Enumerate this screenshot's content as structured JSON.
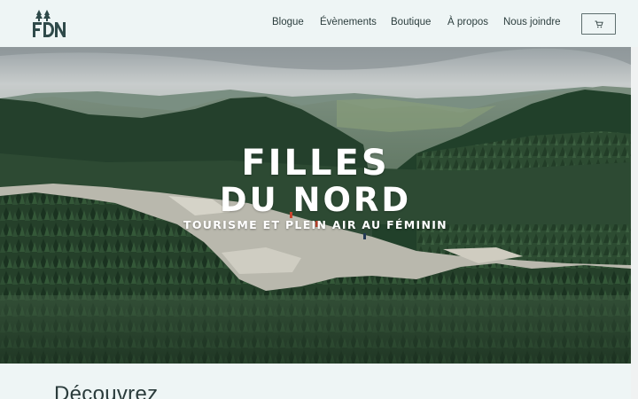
{
  "brand": {
    "logo_text": "FDN"
  },
  "nav": {
    "items": [
      {
        "label": "Blogue"
      },
      {
        "label": "Évènements"
      },
      {
        "label": "Boutique"
      },
      {
        "label": "À propos"
      },
      {
        "label": "Nous joindre"
      }
    ],
    "cart_icon": "cart-icon"
  },
  "hero": {
    "title_line1": "FILLES",
    "title_line2": "DU NORD",
    "tagline": "TOURISME ET PLEIN AIR AU FÉMININ"
  },
  "section": {
    "heading": "Découvrez"
  },
  "colors": {
    "page_bg": "#eef5f5",
    "text": "#2c3e3e",
    "logo": "#2f4a4a",
    "forest_dark": "#1f3a28",
    "forest_light": "#4a6b4a"
  }
}
